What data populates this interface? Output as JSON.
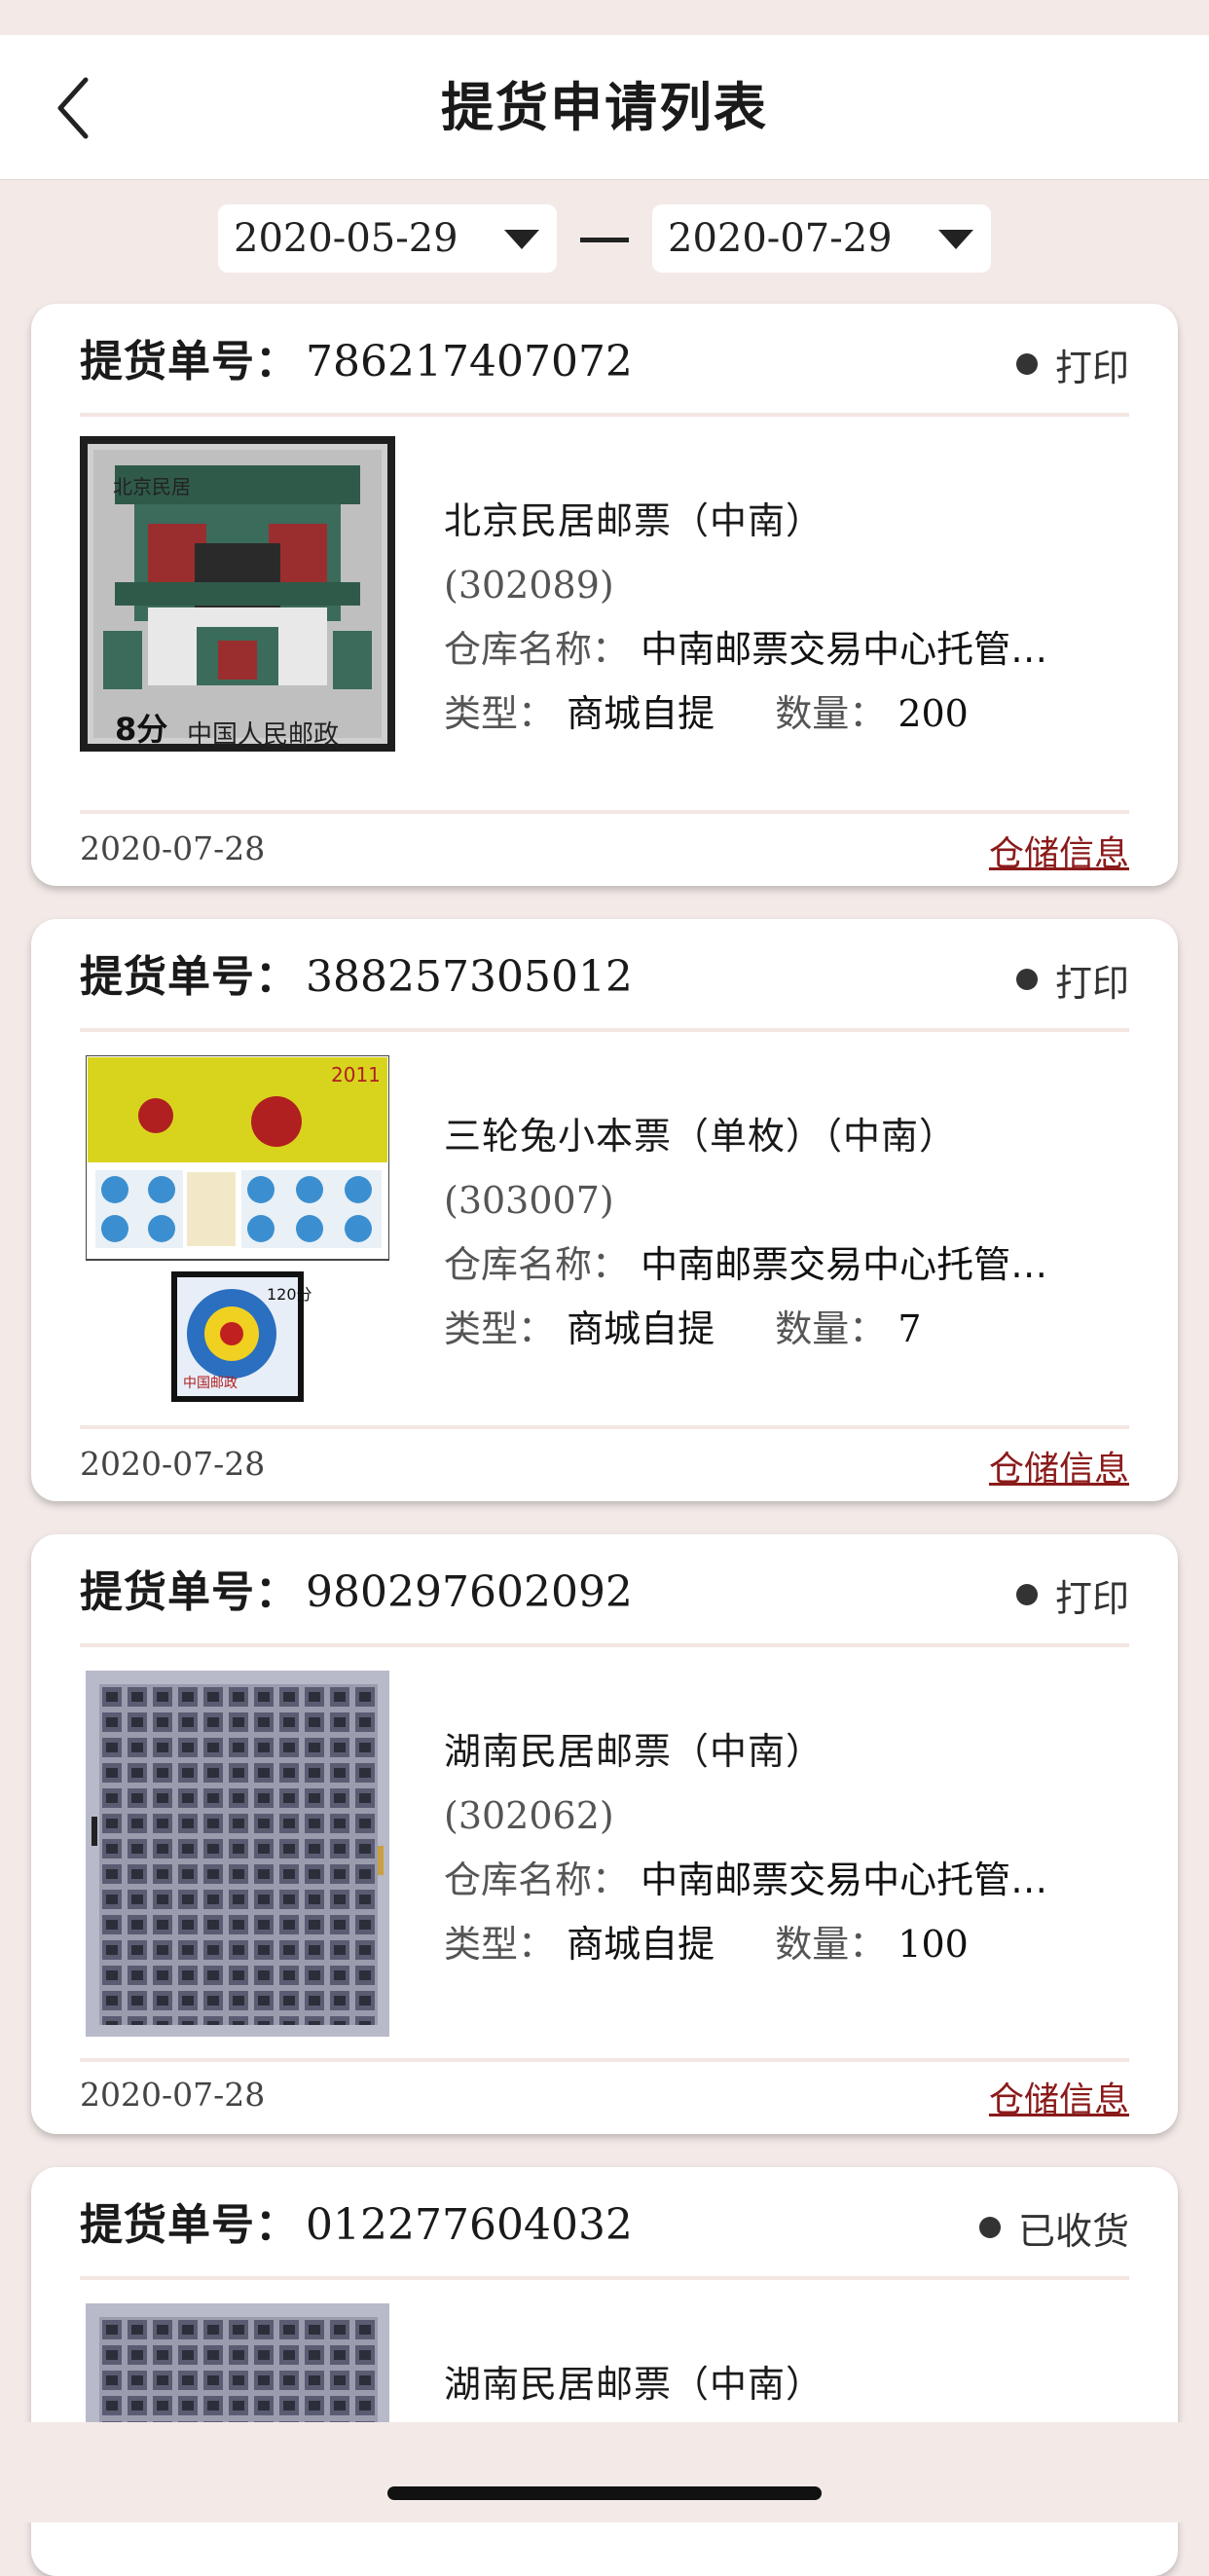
{
  "nav": {
    "title": "提货申请列表"
  },
  "filter": {
    "start_date": "2020-05-29",
    "end_date": "2020-07-29"
  },
  "labels": {
    "order_label": "提货单号：",
    "warehouse_label": "仓库名称：",
    "type_label": "类型：",
    "qty_label": "数量：",
    "storage_link": "仓储信息"
  },
  "orders": [
    {
      "order_no": "786217407072",
      "action": "打印",
      "name": "北京民居邮票（中南）",
      "code": "(302089)",
      "warehouse": "中南邮票交易中心托管…",
      "type": "商城自提",
      "quantity": "200",
      "date": "2020-07-28",
      "image_icon": "stamp-beijing-dwelling"
    },
    {
      "order_no": "388257305012",
      "action": "打印",
      "name": "三轮兔小本票（单枚）（中南）",
      "code": "(303007)",
      "warehouse": "中南邮票交易中心托管…",
      "type": "商城自提",
      "quantity": "7",
      "date": "2020-07-28",
      "image_icon": "stamp-rabbit-booklet"
    },
    {
      "order_no": "980297602092",
      "action": "打印",
      "name": "湖南民居邮票（中南）",
      "code": "(302062)",
      "warehouse": "中南邮票交易中心托管…",
      "type": "商城自提",
      "quantity": "100",
      "date": "2020-07-28",
      "image_icon": "stamp-sheet-hunan"
    },
    {
      "order_no": "012277604032",
      "action": "已收货",
      "name": "湖南民居邮票（中南）",
      "image_icon": "stamp-sheet-hunan"
    }
  ],
  "stamp_text": {
    "beijing_title": "北京民居",
    "denomination": "8分",
    "country": "中国人民邮政",
    "rabbit_year": "2011",
    "rabbit_denom": "120分",
    "rabbit_country": "中国邮政"
  },
  "colors": {
    "background": "#f3eae8",
    "card": "#ffffff",
    "link": "#8b1a1a",
    "divider": "#f3e6e3"
  }
}
